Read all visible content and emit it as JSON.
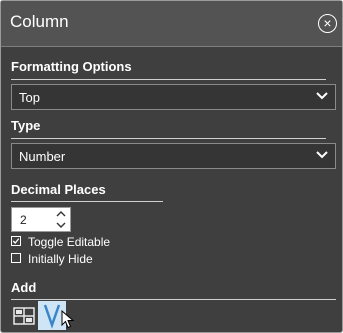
{
  "window": {
    "title": "Column",
    "close_glyph": "×"
  },
  "formatting": {
    "label": "Formatting Options",
    "value": "Top"
  },
  "type": {
    "label": "Type",
    "value": "Number"
  },
  "decimal": {
    "label": "Decimal Places",
    "value": "2"
  },
  "options": [
    {
      "label": "Toggle Editable",
      "checked": true
    },
    {
      "label": "Initially Hide",
      "checked": false
    }
  ],
  "add": {
    "label": "Add",
    "icons": [
      "table-icon",
      "v-icon"
    ]
  },
  "colors": {
    "panel": "#3f3f3f",
    "header": "#535353",
    "field": "#353535",
    "selected_icon_bg": "#cfe4f5"
  }
}
